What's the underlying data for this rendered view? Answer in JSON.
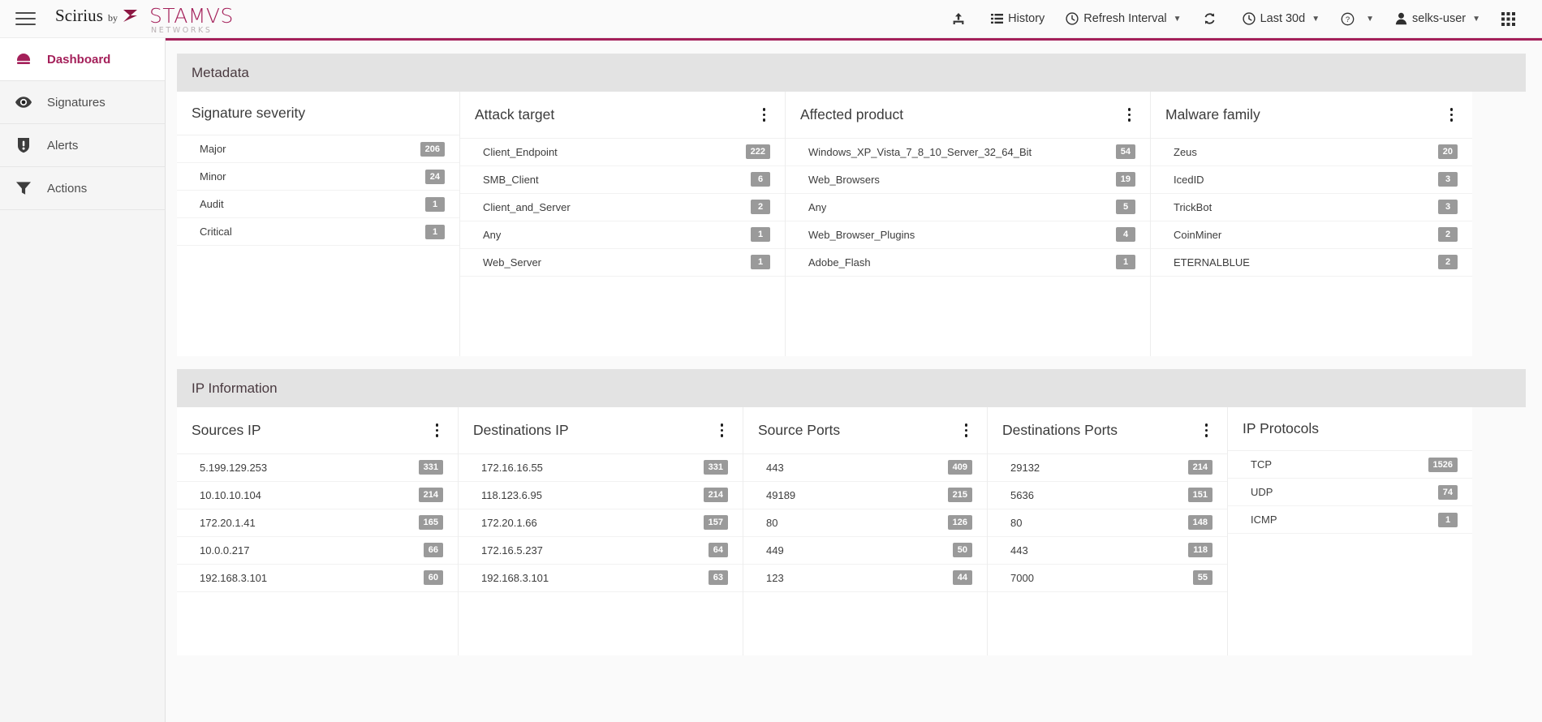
{
  "topbar": {
    "brand_name": "Scirius",
    "brand_by": "by",
    "brand_vendor": "STAMVS",
    "brand_vendor_sub": "NETWORKS",
    "menu_icon": "hamburger-icon",
    "actions": [
      {
        "id": "upload",
        "label": "",
        "icon": "upload-icon",
        "caret": false
      },
      {
        "id": "history",
        "label": "History",
        "icon": "list-icon",
        "caret": false
      },
      {
        "id": "refresh-interval",
        "label": "Refresh Interval",
        "icon": "clock-icon",
        "caret": true
      },
      {
        "id": "refresh",
        "label": "",
        "icon": "refresh-icon",
        "caret": false
      },
      {
        "id": "time-range",
        "label": "Last 30d",
        "icon": "clock-icon",
        "caret": true
      },
      {
        "id": "help",
        "label": "",
        "icon": "question-circle-icon",
        "caret": true
      },
      {
        "id": "user",
        "label": "selks-user",
        "icon": "user-icon",
        "caret": true
      },
      {
        "id": "app-switcher",
        "label": "",
        "icon": "grid-icon",
        "caret": false
      }
    ]
  },
  "sidebar": {
    "items": [
      {
        "label": "Dashboard",
        "icon": "dashboard-gauge-icon",
        "active": true
      },
      {
        "label": "Signatures",
        "icon": "eye-icon",
        "active": false
      },
      {
        "label": "Alerts",
        "icon": "shield-exclamation-icon",
        "active": false
      },
      {
        "label": "Actions",
        "icon": "funnel-icon",
        "active": false
      }
    ]
  },
  "sections": [
    {
      "id": "metadata",
      "title": "Metadata",
      "cards": [
        {
          "title": "Signature severity",
          "menu": false,
          "rows": [
            {
              "label": "Major",
              "count": "206"
            },
            {
              "label": "Minor",
              "count": "24"
            },
            {
              "label": "Audit",
              "count": "1"
            },
            {
              "label": "Critical",
              "count": "1"
            }
          ]
        },
        {
          "title": "Attack target",
          "menu": true,
          "rows": [
            {
              "label": "Client_Endpoint",
              "count": "222"
            },
            {
              "label": "SMB_Client",
              "count": "6"
            },
            {
              "label": "Client_and_Server",
              "count": "2"
            },
            {
              "label": "Any",
              "count": "1"
            },
            {
              "label": "Web_Server",
              "count": "1"
            }
          ]
        },
        {
          "title": "Affected product",
          "menu": true,
          "rows": [
            {
              "label": "Windows_XP_Vista_7_8_10_Server_32_64_Bit",
              "count": "54"
            },
            {
              "label": "Web_Browsers",
              "count": "19"
            },
            {
              "label": "Any",
              "count": "5"
            },
            {
              "label": "Web_Browser_Plugins",
              "count": "4"
            },
            {
              "label": "Adobe_Flash",
              "count": "1"
            }
          ]
        },
        {
          "title": "Malware family",
          "menu": true,
          "rows": [
            {
              "label": "Zeus",
              "count": "20"
            },
            {
              "label": "IcedID",
              "count": "3"
            },
            {
              "label": "TrickBot",
              "count": "3"
            },
            {
              "label": "CoinMiner",
              "count": "2"
            },
            {
              "label": "ETERNALBLUE",
              "count": "2"
            }
          ]
        }
      ]
    },
    {
      "id": "ip-information",
      "title": "IP Information",
      "cards": [
        {
          "title": "Sources IP",
          "menu": true,
          "rows": [
            {
              "label": "5.199.129.253",
              "count": "331"
            },
            {
              "label": "10.10.10.104",
              "count": "214"
            },
            {
              "label": "172.20.1.41",
              "count": "165"
            },
            {
              "label": "10.0.0.217",
              "count": "66"
            },
            {
              "label": "192.168.3.101",
              "count": "60"
            }
          ]
        },
        {
          "title": "Destinations IP",
          "menu": true,
          "rows": [
            {
              "label": "172.16.16.55",
              "count": "331"
            },
            {
              "label": "118.123.6.95",
              "count": "214"
            },
            {
              "label": "172.20.1.66",
              "count": "157"
            },
            {
              "label": "172.16.5.237",
              "count": "64"
            },
            {
              "label": "192.168.3.101",
              "count": "63"
            }
          ]
        },
        {
          "title": "Source Ports",
          "menu": true,
          "rows": [
            {
              "label": "443",
              "count": "409"
            },
            {
              "label": "49189",
              "count": "215"
            },
            {
              "label": "80",
              "count": "126"
            },
            {
              "label": "449",
              "count": "50"
            },
            {
              "label": "123",
              "count": "44"
            }
          ]
        },
        {
          "title": "Destinations Ports",
          "menu": true,
          "rows": [
            {
              "label": "29132",
              "count": "214"
            },
            {
              "label": "5636",
              "count": "151"
            },
            {
              "label": "80",
              "count": "148"
            },
            {
              "label": "443",
              "count": "118"
            },
            {
              "label": "7000",
              "count": "55"
            }
          ]
        },
        {
          "title": "IP Protocols",
          "menu": false,
          "rows": [
            {
              "label": "TCP",
              "count": "1526"
            },
            {
              "label": "UDP",
              "count": "74"
            },
            {
              "label": "ICMP",
              "count": "1"
            }
          ]
        }
      ]
    }
  ],
  "colors": {
    "accent": "#a4205a",
    "badge": "#9a9a9a",
    "section_header_bg": "#e3e3e3"
  }
}
